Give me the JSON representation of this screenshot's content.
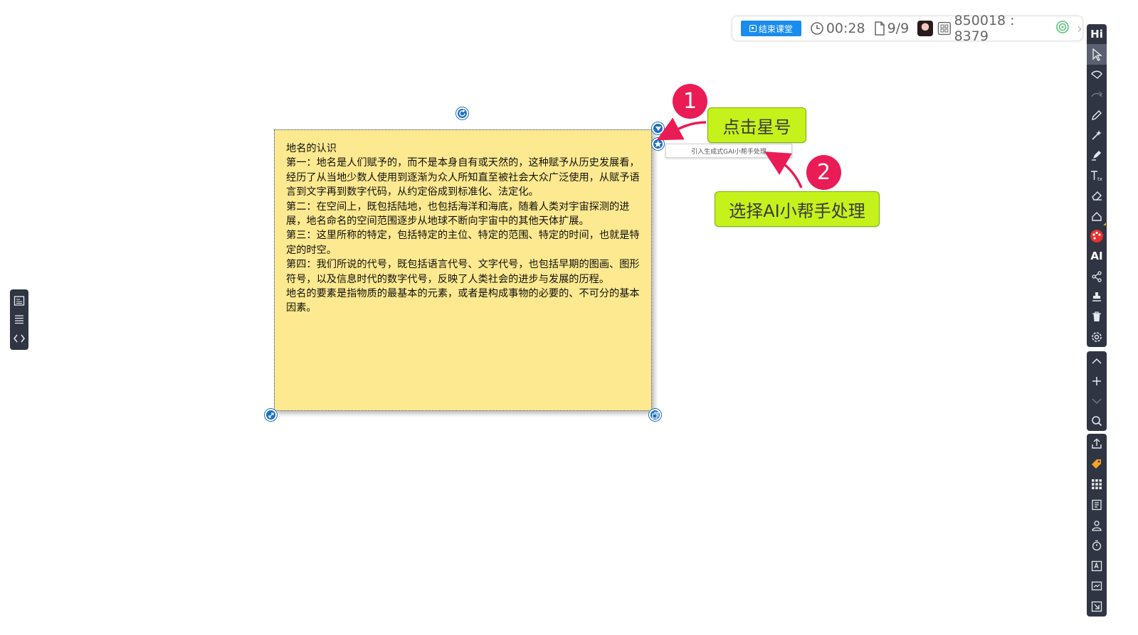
{
  "topbar": {
    "end_class_label": "结束课堂",
    "timer": "00:28",
    "pages": "9/9",
    "class_code": "850018 : 8379"
  },
  "toolbar": {
    "logo": "Hi",
    "ai_label": "AI",
    "icons": [
      "select-icon",
      "undo-icon",
      "redo-icon",
      "pen-icon",
      "laser-pen-icon",
      "highlighter-icon",
      "text-icon",
      "eraser-icon",
      "shape-icon",
      "color-palette-icon",
      "ai-icon",
      "share-icon",
      "stamp-icon",
      "trash-icon",
      "settings-icon",
      "chevron-up-icon",
      "add-page-icon",
      "chevron-down-icon",
      "zoom-icon",
      "upload-icon",
      "tag-icon",
      "apps-grid-icon",
      "list-icon",
      "user-icon",
      "stopwatch-icon",
      "text-box-icon",
      "screenshot-icon",
      "exit-icon"
    ]
  },
  "note": {
    "lines": [
      "地名的认识",
      "第一：地名是人们赋予的，而不是本身自有或天然的，这种赋予从历史发展看，经历了从当地少数人使用到逐渐为众人所知直至被社会大众广泛使用，从赋予语言到文字再到数字代码，从约定俗成到标准化、法定化。",
      "第二：在空间上，既包括陆地，也包括海洋和海底，随着人类对宇宙探测的进展，地名命名的空间范围逐步从地球不断向宇宙中的其他天体扩展。",
      "第三：这里所称的特定，包括特定的主位、特定的范围、特定的时间，也就是特定的时空。",
      "第四：我们所说的代号，既包括语言代号、文字代号，也包括早期的图画、图形符号，以及信息时代的数字代号，反映了人类社会的进步与发展的历程。",
      "地名的要素是指物质的最基本的元素，或者是构成事物的必要的、不可分的基本因素。"
    ]
  },
  "context_menu": {
    "item": "引入生成式GAI小帮手处理"
  },
  "annotations": {
    "step1_number": "1",
    "step1_text": "点击星号",
    "step2_number": "2",
    "step2_text": "选择AI小帮手处理",
    "accent": "#ea1c55",
    "callout_color": "#c4f21a"
  },
  "colors": {
    "note_bg": "#fde98f",
    "handle": "#1e6fc0",
    "toolbar_bg": "#2f3542",
    "end_button": "#1a8cf0"
  }
}
